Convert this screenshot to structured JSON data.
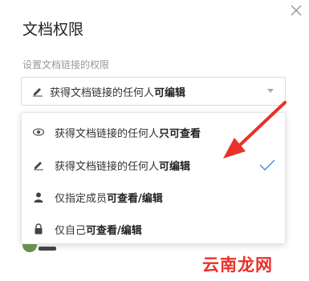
{
  "dialog": {
    "title": "文档权限",
    "section_label": "设置文档链接的权限"
  },
  "select": {
    "selected_prefix": "获得文档链接的任何人",
    "selected_bold": "可编辑"
  },
  "menu": {
    "items": [
      {
        "icon": "eye-icon",
        "prefix": "获得文档链接的任何人",
        "bold": "只可查看",
        "selected": false
      },
      {
        "icon": "pencil-icon",
        "prefix": "获得文档链接的任何人",
        "bold": "可编辑",
        "selected": true
      },
      {
        "icon": "user-icon",
        "prefix": "仅指定成员",
        "bold": "可查看/编辑",
        "selected": false
      },
      {
        "icon": "lock-icon",
        "prefix": "仅自己",
        "bold": "可查看/编辑",
        "selected": false
      }
    ]
  },
  "watermark": {
    "text": "云南龙网",
    "color": "#e8312a"
  },
  "colors": {
    "accent": "#4a90e2",
    "arrow": "#e8312a"
  }
}
